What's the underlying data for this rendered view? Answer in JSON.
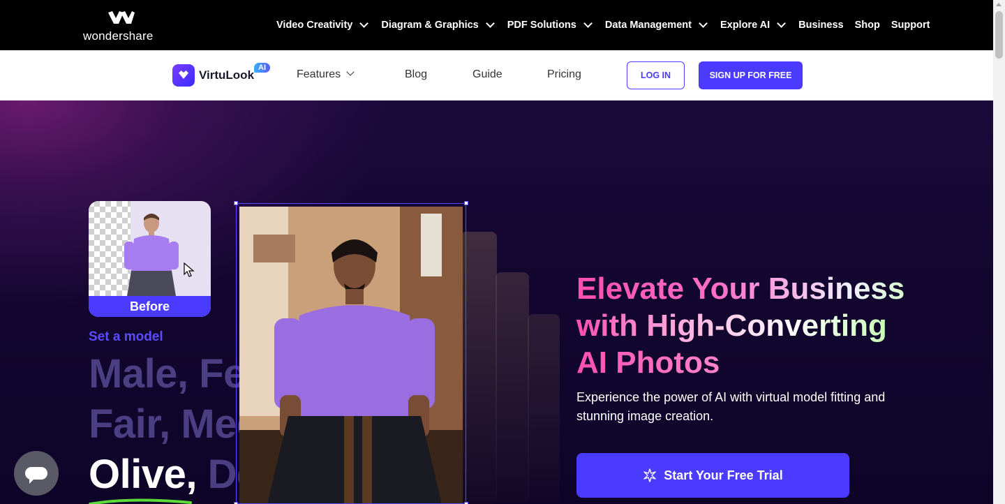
{
  "topbar": {
    "brand": "wondershare",
    "nav": [
      {
        "label": "Video Creativity",
        "dropdown": true
      },
      {
        "label": "Diagram & Graphics",
        "dropdown": true
      },
      {
        "label": "PDF Solutions",
        "dropdown": true
      },
      {
        "label": "Data Management",
        "dropdown": true
      },
      {
        "label": "Explore AI",
        "dropdown": true
      },
      {
        "label": "Business",
        "dropdown": false
      },
      {
        "label": "Shop",
        "dropdown": false
      },
      {
        "label": "Support",
        "dropdown": false
      }
    ]
  },
  "product": {
    "name": "VirtuLook",
    "badge": "AI",
    "nav": {
      "features": "Features",
      "blog": "Blog",
      "guide": "Guide",
      "pricing": "Pricing"
    },
    "login_label": "LOG IN",
    "signup_label": "SIGN UP FOR FREE"
  },
  "hero": {
    "before_label": "Before",
    "set_model": "Set a model",
    "options_line1": "Male, Female,",
    "options_line2": "Fair, Medium,",
    "options_line3_active": "Olive,",
    "options_line3_rest": " Deep,",
    "headline": {
      "line1": "Elevate Your Business",
      "line2": "with High-Converting",
      "line3": "AI Photos"
    },
    "subtext": "Experience the power of AI with virtual model fitting and stunning image creation.",
    "cta_label": "Start Your Free Trial"
  },
  "colors": {
    "brand": "#4b3bff",
    "hero_bg": "#12062e",
    "headline_pink": "#ff4fb0",
    "headline_green": "#a8ff8a"
  },
  "icons": {
    "brand": "wondershare-logo-icon",
    "product": "virtulook-logo-icon",
    "cta": "sparkle-icon",
    "chat": "chat-bubble-icon",
    "cursor": "mouse-pointer-icon"
  }
}
